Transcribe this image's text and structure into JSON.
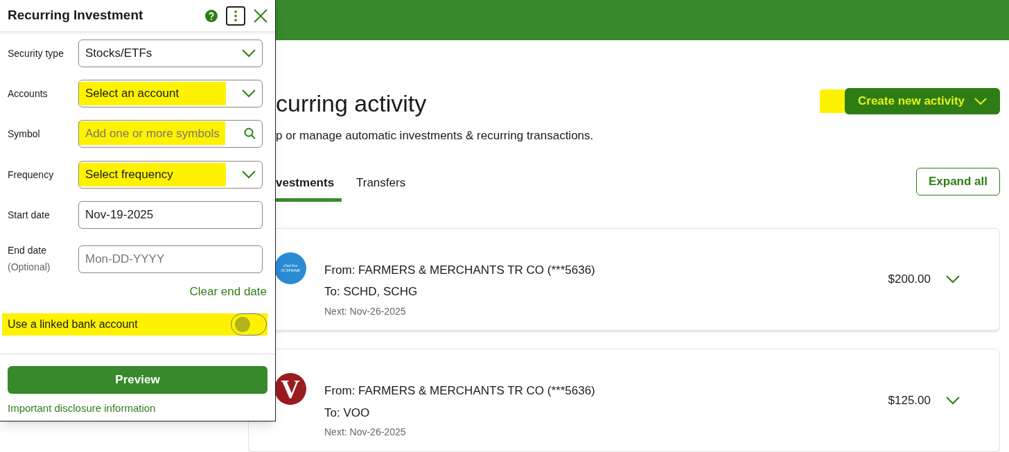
{
  "panel": {
    "title": "Recurring Investment",
    "fields": [
      {
        "kind": "select",
        "label": "Security type",
        "value": "Stocks/ETFs",
        "highlighted": false
      },
      {
        "kind": "select",
        "label": "Accounts",
        "value": "Select an account",
        "highlighted": true
      },
      {
        "kind": "search",
        "label": "Symbol",
        "placeholder": "Add one or more symbols",
        "highlighted": true
      },
      {
        "kind": "select",
        "label": "Frequency",
        "value": "Select frequency",
        "highlighted": true
      },
      {
        "kind": "text",
        "label": "Start date",
        "value": "Nov-19-2025",
        "highlighted": false
      },
      {
        "kind": "text",
        "label": "End date",
        "sublabel": "(Optional)",
        "placeholder": "Mon-DD-YYYY",
        "highlighted": false
      }
    ],
    "clear_link": "Clear end date",
    "toggle": {
      "label": "Use a linked bank account",
      "on": false,
      "highlighted": true
    },
    "primary_button": "Preview",
    "disclosure_link": "Important disclosure information"
  },
  "page": {
    "title": "curring activity",
    "subtitle": "p or manage automatic investments & recurring transactions.",
    "create_button": {
      "label": "Create new activity",
      "highlighted": true
    },
    "tabs": [
      {
        "label": "vestments",
        "selected": true
      },
      {
        "label": "Transfers",
        "selected": false
      }
    ],
    "expand_button": "Expand all",
    "activities": [
      {
        "logo_lines": [
          "charles",
          "SCHWAB"
        ],
        "color": "#2a8ad4",
        "from": "From: FARMERS & MERCHANTS TR CO (***5636)",
        "to": "To: SCHD, SCHG",
        "next": "Next: Nov-26-2025",
        "amount": "$200.00"
      },
      {
        "logo_lines": [
          "V"
        ],
        "color": "#9a1b20",
        "from": "From: FARMERS & MERCHANTS TR CO (***5636)",
        "to": "To: VOO",
        "next": "Next: Nov-26-2025",
        "amount": "$125.00"
      }
    ]
  }
}
